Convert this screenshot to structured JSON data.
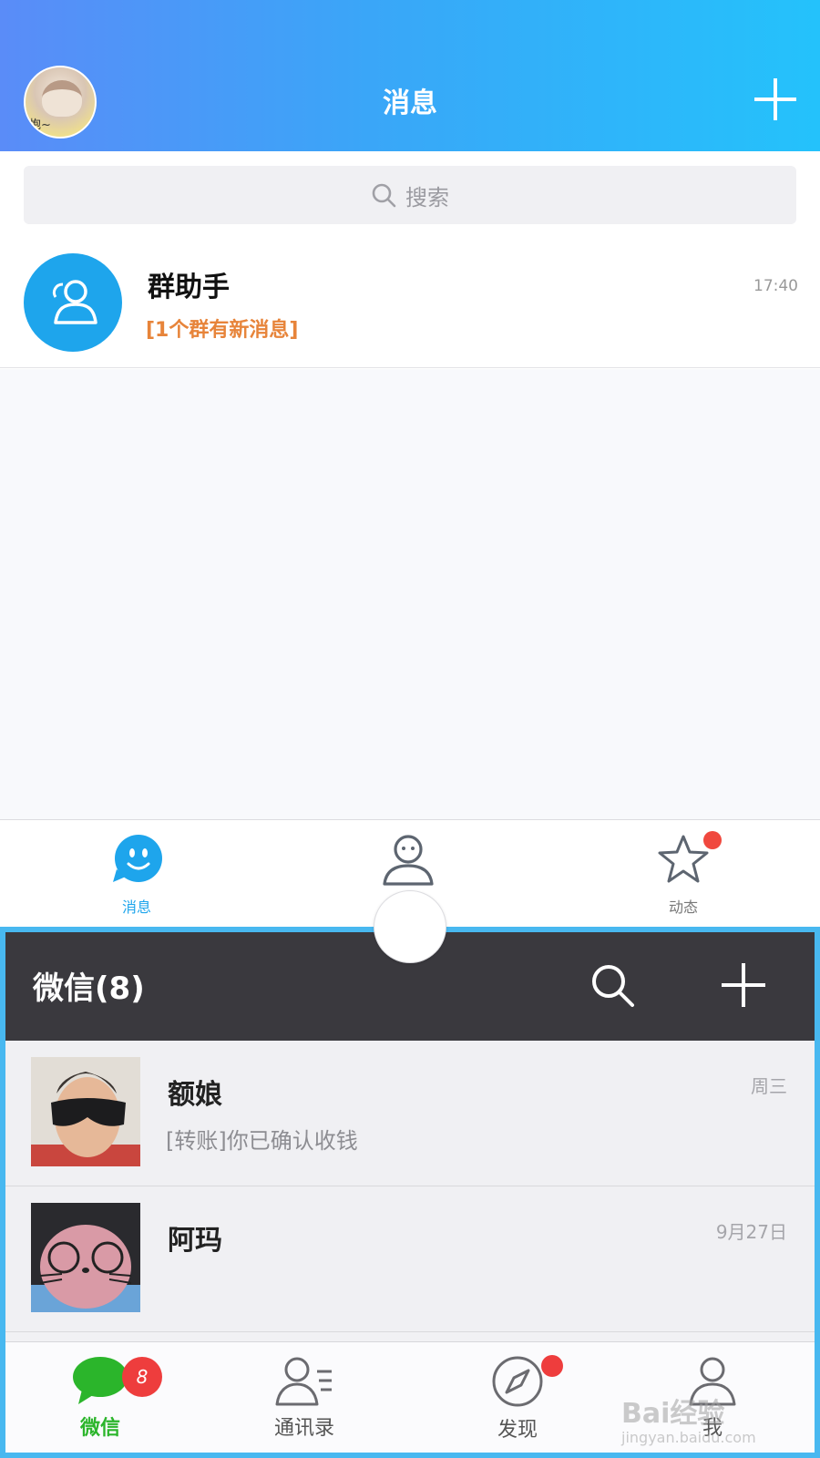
{
  "qq": {
    "header": {
      "title": "消息",
      "avatar_text": "抱~"
    },
    "search": {
      "placeholder": "搜索"
    },
    "conversations": [
      {
        "name": "群助手",
        "preview": "[1个群有新消息]",
        "time": "17:40"
      }
    ],
    "tabs": [
      {
        "label": "消息",
        "icon": "smile-bubble-icon",
        "active": true
      },
      {
        "label": "",
        "icon": "contact-person-icon",
        "active": false
      },
      {
        "label": "动态",
        "icon": "star-icon",
        "active": false,
        "has_dot": true
      }
    ],
    "colors": {
      "accent": "#1ea5ec",
      "preview": "#e7843a",
      "dot": "#f0483e"
    }
  },
  "wechat": {
    "header": {
      "title": "微信(8)"
    },
    "chats": [
      {
        "name": "额娘",
        "preview": "[转账]你已确认收钱",
        "time": "周三"
      },
      {
        "name": "阿玛",
        "preview": "",
        "time": "9月27日"
      }
    ],
    "tabs": [
      {
        "label": "微信",
        "icon": "chat-bubble-icon",
        "badge": "8",
        "active": true
      },
      {
        "label": "通讯录",
        "icon": "contacts-icon",
        "active": false
      },
      {
        "label": "发现",
        "icon": "compass-icon",
        "active": false,
        "has_dot": true
      },
      {
        "label": "我",
        "icon": "me-person-icon",
        "active": false
      }
    ],
    "colors": {
      "header": "#3a393e",
      "active": "#2bb52b",
      "badge": "#ee3d3d",
      "frame": "#48b8f0"
    }
  },
  "watermark": {
    "brand": "Bai经验",
    "url": "jingyan.baidu.com"
  }
}
